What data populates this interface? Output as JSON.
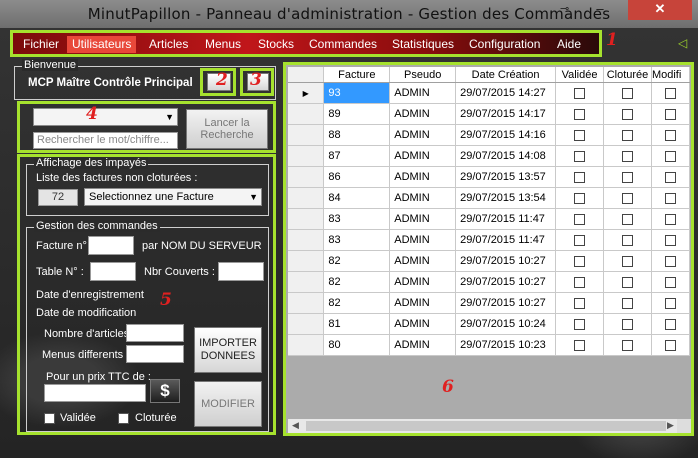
{
  "window": {
    "title": "MinutPapillon - Panneau d'administration - Gestion des Commandes",
    "minimize": "–",
    "close": "✕"
  },
  "menu": [
    "Fichier",
    "Utilisateurs",
    "Articles",
    "Menus",
    "Stocks",
    "Commandes",
    "Statistiques",
    "Configuration",
    "Aide"
  ],
  "active_menu": "Utilisateurs",
  "annotations": {
    "a1": "1",
    "a2": "2",
    "a3": "3",
    "a4": "4",
    "a5": "5",
    "a6": "6"
  },
  "welcome": {
    "legend": "Bienvenue",
    "user": "MCP Maître Contrôle Principal"
  },
  "search": {
    "placeholder": "Rechercher le mot/chiffre...",
    "button": "Lancer la Recherche"
  },
  "unpaid": {
    "legend": "Affichage des impayés",
    "label": "Liste des factures non cloturées :",
    "count": "72",
    "select": "Selectionnez une Facture"
  },
  "orders": {
    "legend": "Gestion des commandes",
    "invoice_label": "Facture n°",
    "server_label": "par NOM DU SERVEUR",
    "table_label": "Table N° :",
    "covers_label": "Nbr Couverts :",
    "registered_label": "Date d'enregistrement",
    "modified_label": "Date de modification",
    "articles_label": "Nombre d'articles :",
    "menus_label": "Menus differents :",
    "price_label": "Pour un prix TTC de :",
    "import_button": "IMPORTER DONNEES",
    "modify_button": "MODIFIER",
    "dollar_icon": "$",
    "validated_label": "Validée",
    "closed_label": "Cloturée"
  },
  "grid": {
    "columns": [
      "Facture",
      "Pseudo",
      "Date Création",
      "Validée",
      "Cloturée",
      "Modifi"
    ],
    "rows": [
      [
        "93",
        "ADMIN",
        "29/07/2015 14:27"
      ],
      [
        "89",
        "ADMIN",
        "29/07/2015 14:17"
      ],
      [
        "88",
        "ADMIN",
        "29/07/2015 14:16"
      ],
      [
        "87",
        "ADMIN",
        "29/07/2015 14:08"
      ],
      [
        "86",
        "ADMIN",
        "29/07/2015 13:57"
      ],
      [
        "84",
        "ADMIN",
        "29/07/2015 13:54"
      ],
      [
        "83",
        "ADMIN",
        "29/07/2015 11:47"
      ],
      [
        "83",
        "ADMIN",
        "29/07/2015 11:47"
      ],
      [
        "82",
        "ADMIN",
        "29/07/2015 10:27"
      ],
      [
        "82",
        "ADMIN",
        "29/07/2015 10:27"
      ],
      [
        "82",
        "ADMIN",
        "29/07/2015 10:27"
      ],
      [
        "81",
        "ADMIN",
        "29/07/2015 10:24"
      ],
      [
        "80",
        "ADMIN",
        "29/07/2015 10:23"
      ]
    ],
    "current_row_marker": "▶"
  },
  "colors": {
    "accent": "#a6e22e",
    "menu_bg": "#c0161a",
    "active_menu": "#e8483a",
    "annotation": "#e02020",
    "selected_cell": "#3399ff"
  }
}
